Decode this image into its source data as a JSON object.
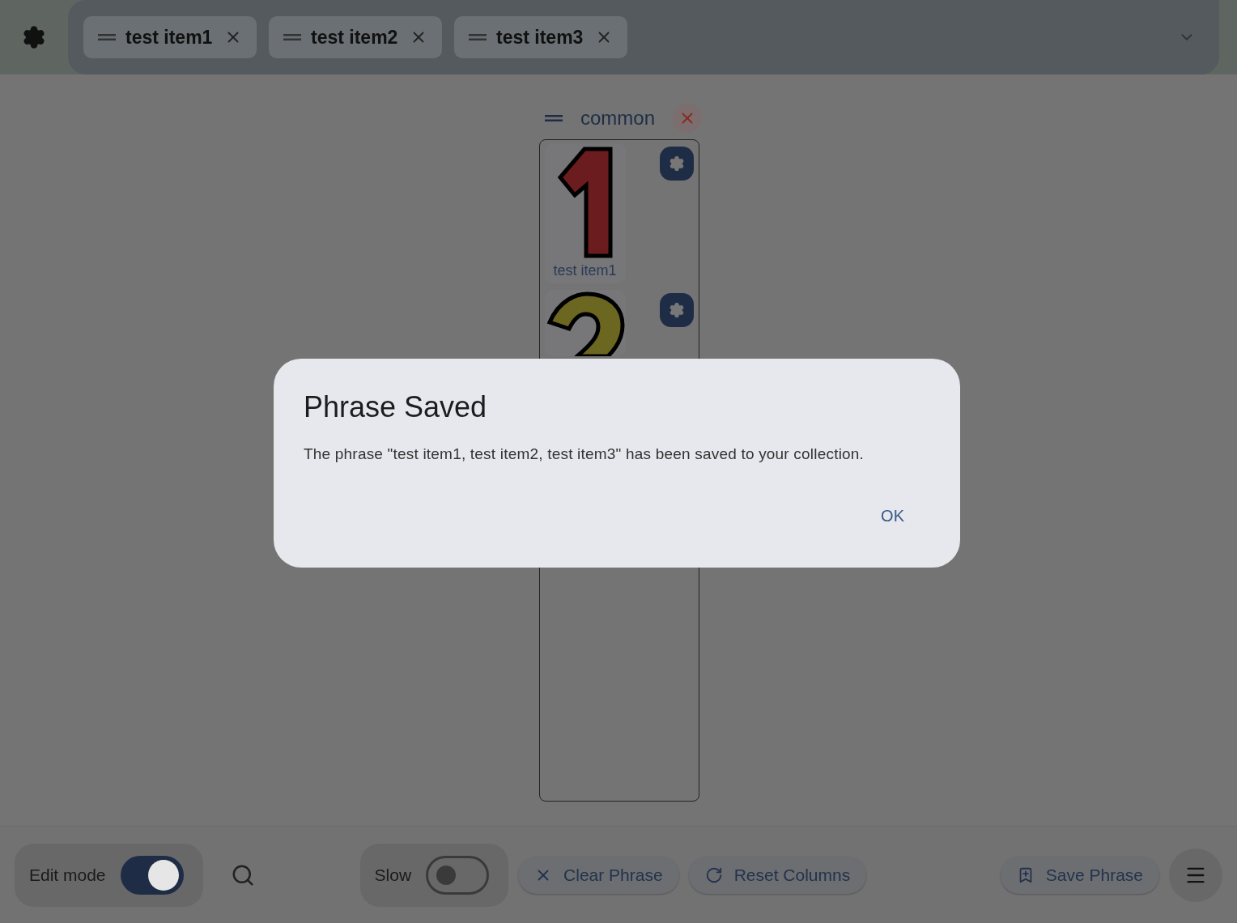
{
  "header": {
    "chips": [
      {
        "label": "test item1"
      },
      {
        "label": "test item2"
      },
      {
        "label": "test item3"
      }
    ]
  },
  "column": {
    "title": "common",
    "items": [
      {
        "kind": "one",
        "color": "#6b1c1e",
        "label": "test item1"
      },
      {
        "kind": "two",
        "color": "#6b6620"
      }
    ]
  },
  "dialog": {
    "title": "Phrase Saved",
    "message": "The phrase \"test item1, test item2, test item3\" has been saved to your collection.",
    "button": "OK"
  },
  "footer": {
    "edit_mode": {
      "label": "Edit mode",
      "on": true
    },
    "slow": {
      "label": "Slow",
      "on": false
    },
    "buttons": [
      {
        "kind": "clear",
        "label": "Clear Phrase"
      },
      {
        "kind": "reset",
        "label": "Reset Columns"
      },
      {
        "kind": "save",
        "label": "Save Phrase"
      }
    ]
  }
}
